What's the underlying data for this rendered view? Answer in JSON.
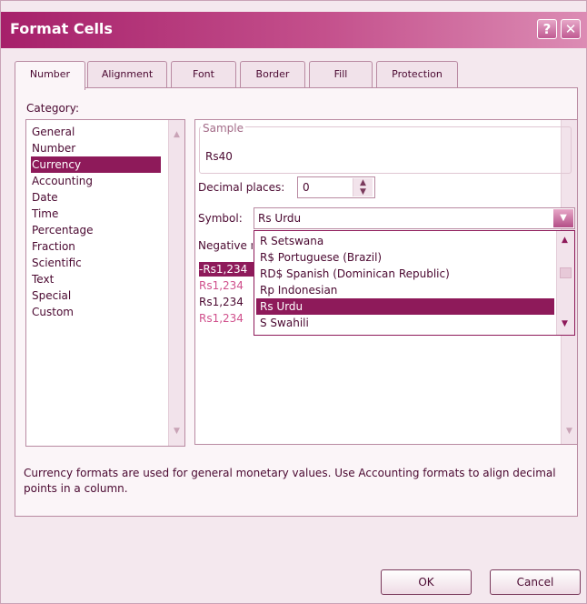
{
  "window": {
    "title": "Format Cells",
    "help_glyph": "?",
    "close_glyph": "✕"
  },
  "tabs": [
    {
      "label": "Number",
      "active": true
    },
    {
      "label": "Alignment"
    },
    {
      "label": "Font"
    },
    {
      "label": "Border"
    },
    {
      "label": "Fill"
    },
    {
      "label": "Protection"
    }
  ],
  "category": {
    "label": "Category:",
    "items": [
      "General",
      "Number",
      "Currency",
      "Accounting",
      "Date",
      "Time",
      "Percentage",
      "Fraction",
      "Scientific",
      "Text",
      "Special",
      "Custom"
    ],
    "selected": "Currency"
  },
  "sample": {
    "legend": "Sample",
    "value": "Rs40"
  },
  "decimal_places": {
    "label": "Decimal places:",
    "value": "0"
  },
  "symbol": {
    "label": "Symbol:",
    "value": "Rs Urdu",
    "dropdown_items": [
      "R Setswana",
      "R$ Portuguese (Brazil)",
      "RD$ Spanish (Dominican Republic)",
      "Rp Indonesian",
      "Rs Urdu",
      "S Swahili"
    ],
    "selected": "Rs Urdu"
  },
  "negative_numbers": {
    "label": "Negative numbers:",
    "items": [
      "-Rs1,234",
      "Rs1,234",
      "Rs1,234",
      "Rs1,234"
    ]
  },
  "description": "Currency formats are used for general monetary values.  Use Accounting formats to align decimal points in a column.",
  "buttons": {
    "ok": "OK",
    "cancel": "Cancel"
  },
  "colors": {
    "accent": "#8e1a5a",
    "title_bar_start": "#a6206a",
    "negative_red": "#d0508c"
  }
}
